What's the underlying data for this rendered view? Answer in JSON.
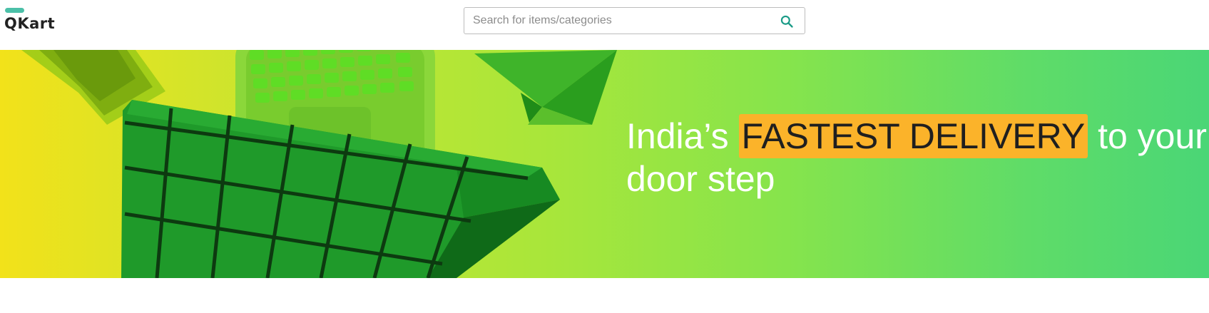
{
  "header": {
    "logo_text": "QKart",
    "search": {
      "placeholder": "Search for items/categories",
      "value": "",
      "icon": "search-icon"
    }
  },
  "banner": {
    "text_before": "India’s ",
    "highlight": "FASTEST DELIVERY",
    "text_after": " to your door step",
    "colors": {
      "gradient_start": "#f2e21a",
      "gradient_end": "#4ad676",
      "highlight_bg": "#fbb32a",
      "text": "#ffffff"
    }
  },
  "colors": {
    "accent": "#4bc0a8",
    "search_icon": "#1a9b87"
  }
}
